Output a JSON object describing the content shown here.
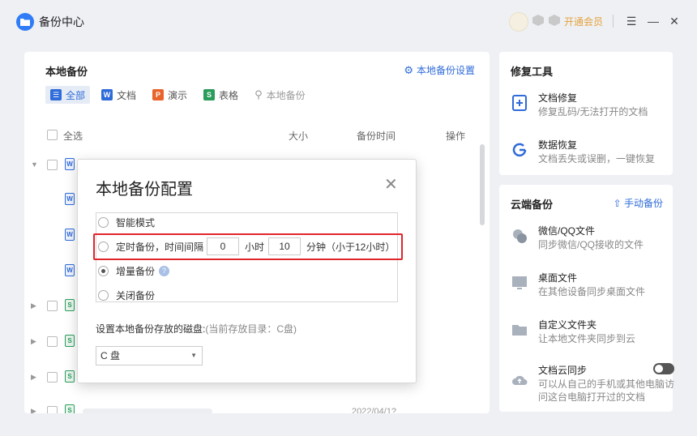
{
  "app": {
    "title": "备份中心",
    "vip_label": "开通会员"
  },
  "main": {
    "title": "本地备份",
    "settings_link": "本地备份设置",
    "tabs": [
      {
        "label": "全部",
        "icon": "list-icon",
        "active": true
      },
      {
        "label": "文档",
        "icon": "W"
      },
      {
        "label": "演示",
        "icon": "P"
      },
      {
        "label": "表格",
        "icon": "S"
      },
      {
        "label": "本地备份",
        "icon": "search-icon"
      }
    ],
    "columns": {
      "select_all": "全选",
      "size": "大小",
      "time": "备份时间",
      "action": "操作"
    },
    "row_partial_time": "2022/04/1?"
  },
  "repair": {
    "title": "修复工具",
    "items": [
      {
        "title": "文档修复",
        "desc": "修复乱码/无法打开的文档"
      },
      {
        "title": "数据恢复",
        "desc": "文档丢失或误删，一键恢复"
      }
    ]
  },
  "cloud": {
    "title": "云端备份",
    "action": "手动备份",
    "items": [
      {
        "title": "微信/QQ文件",
        "desc": "同步微信/QQ接收的文件"
      },
      {
        "title": "桌面文件",
        "desc": "在其他设备同步桌面文件"
      },
      {
        "title": "自定义文件夹",
        "desc": "让本地文件夹同步到云"
      },
      {
        "title": "文档云同步",
        "desc": "可以从自己的手机或其他电脑访问这台电脑打开过的文档"
      }
    ]
  },
  "dialog": {
    "title": "本地备份配置",
    "options": {
      "smart": "智能模式",
      "timed": "定时备份，时间间隔",
      "incremental": "增量备份",
      "off": "关闭备份"
    },
    "hours_value": "0",
    "hours_unit": "小时",
    "minutes_value": "10",
    "minutes_unit": "分钟（小于12小时）",
    "help_mark": "?",
    "disk_label": "设置本地备份存放的磁盘:",
    "disk_current": "(当前存放目录：C盘)",
    "disk_value": "C 盘"
  }
}
